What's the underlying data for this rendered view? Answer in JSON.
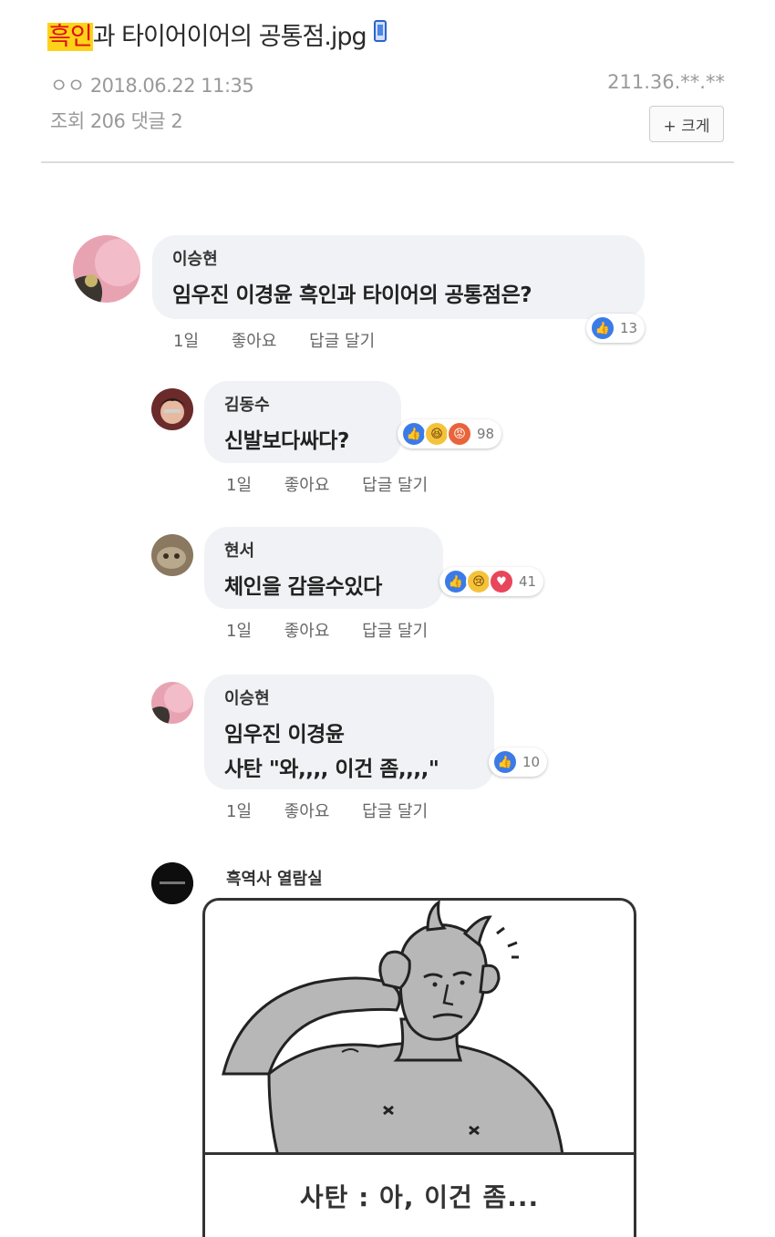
{
  "post": {
    "title_highlight": "흑인",
    "title_rest": "과 타이어이어의 공통점.jpg",
    "author_and_date": "ㅇㅇ 2018.06.22 11:35",
    "stats": "조회 206 댓글 2",
    "ip": "211.36.**.**",
    "enlarge_button": "+ 크게"
  },
  "comments": [
    {
      "author": "이승현",
      "text": "임우진 이경윤 흑인과 타이어의 공통점은?",
      "time": "1일",
      "like": "좋아요",
      "reply": "답글 달기",
      "reactions": "13"
    },
    {
      "author": "김동수",
      "text": "신발보다싸다?",
      "time": "1일",
      "like": "좋아요",
      "reply": "답글 달기",
      "reactions": "98"
    },
    {
      "author": "현서",
      "text": "체인을 감을수있다",
      "time": "1일",
      "like": "좋아요",
      "reply": "답글 달기",
      "reactions": "41"
    },
    {
      "author": "이승현",
      "text_line1": "임우진 이경윤",
      "text_line2": "사탄 \"와,,,, 이건 좀,,,,\"",
      "time": "1일",
      "like": "좋아요",
      "reply": "답글 달기",
      "reactions": "10"
    },
    {
      "author": "흑역사 열람실",
      "image_caption": "사탄 : 아, 이건 좀..."
    }
  ],
  "colors": {
    "highlight_bg": "#ffd21a",
    "highlight_text": "#d11111",
    "like_blue": "#3b7be8",
    "bubble_bg": "#f0f2f5"
  },
  "icons": [
    "phone-icon",
    "like-icon",
    "haha-icon",
    "angry-icon",
    "sad-icon",
    "love-icon"
  ]
}
